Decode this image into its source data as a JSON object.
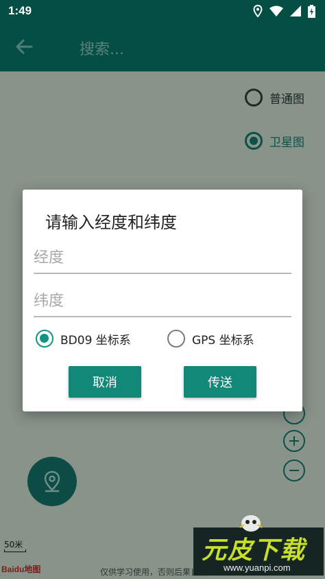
{
  "status_bar": {
    "time": "1:49",
    "icons": [
      "location-pin-icon",
      "wifi-icon",
      "cellular-signal-icon",
      "battery-charging-icon"
    ]
  },
  "app_bar": {
    "back_icon": "arrow-back-icon",
    "search_placeholder": "搜索..."
  },
  "map": {
    "map_types": [
      {
        "label": "普通图",
        "selected": false
      },
      {
        "label": "卫星图",
        "selected": true
      }
    ],
    "zoom_buttons": [
      "zoom-in-icon",
      "zoom-out-icon"
    ],
    "fab_icon": "location-pin-icon",
    "scale_label": "50米",
    "baidu_logo": "Baidu地图",
    "footer_text": "仅供学习使用，否则后果自负"
  },
  "dialog": {
    "title": "请输入经度和纬度",
    "longitude_placeholder": "经度",
    "latitude_placeholder": "纬度",
    "coord_options": [
      {
        "label": "BD09 坐标系",
        "selected": true
      },
      {
        "label": "GPS 坐标系",
        "selected": false
      }
    ],
    "cancel_label": "取消",
    "send_label": "传送"
  },
  "watermark": {
    "text": "元皮下载",
    "url": "www.yuanpi.com"
  },
  "colors": {
    "primary_dark": "#054e44",
    "accent": "#119483",
    "button": "#118878"
  }
}
